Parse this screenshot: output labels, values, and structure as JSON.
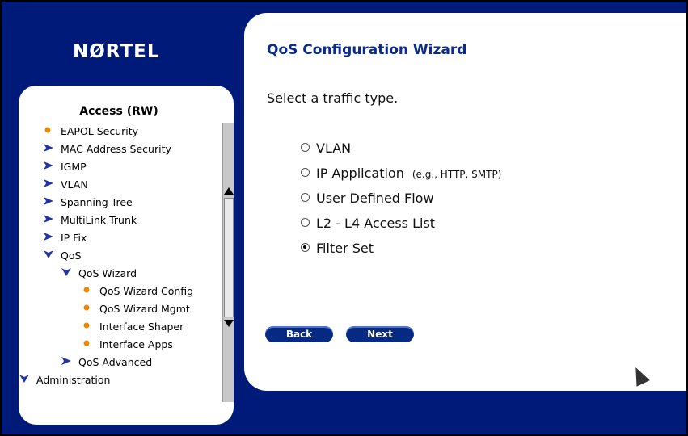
{
  "brand": {
    "logo_text": "NØRTEL"
  },
  "sidebar": {
    "title": "Access (RW)",
    "items": [
      {
        "label": "EAPOL Security",
        "icon": "bullet-orange"
      },
      {
        "label": "MAC Address Security",
        "icon": "chevron-right-blue"
      },
      {
        "label": "IGMP",
        "icon": "chevron-right-blue"
      },
      {
        "label": "VLAN",
        "icon": "chevron-right-blue"
      },
      {
        "label": "Spanning Tree",
        "icon": "chevron-right-blue"
      },
      {
        "label": "MultiLink Trunk",
        "icon": "chevron-right-blue"
      },
      {
        "label": "IP Fix",
        "icon": "chevron-right-blue"
      },
      {
        "label": "QoS",
        "icon": "chevron-down-blue"
      },
      {
        "label": "QoS Wizard",
        "icon": "chevron-down-blue"
      },
      {
        "label": "QoS Wizard Config",
        "icon": "bullet-orange"
      },
      {
        "label": "QoS Wizard Mgmt",
        "icon": "bullet-orange"
      },
      {
        "label": "Interface Shaper",
        "icon": "bullet-orange"
      },
      {
        "label": "Interface Apps",
        "icon": "bullet-orange"
      },
      {
        "label": "QoS Advanced",
        "icon": "chevron-right-blue"
      },
      {
        "label": "Administration",
        "icon": "chevron-down-blue"
      }
    ]
  },
  "main": {
    "title": "QoS Configuration Wizard",
    "prompt": "Select a traffic type.",
    "options": [
      {
        "label": "VLAN",
        "hint": "",
        "selected": false
      },
      {
        "label": "IP Application",
        "hint": "(e.g., HTTP, SMTP)",
        "selected": false
      },
      {
        "label": "User Defined Flow",
        "hint": "",
        "selected": false
      },
      {
        "label": "L2 - L4 Access List",
        "hint": "",
        "selected": false
      },
      {
        "label": "Filter Set",
        "hint": "",
        "selected": true
      }
    ],
    "back_label": "Back",
    "next_label": "Next"
  },
  "colors": {
    "background": "#001a7a",
    "title": "#0a2a8c",
    "bullet": "#e98a00",
    "chevron": "#2233a8"
  }
}
